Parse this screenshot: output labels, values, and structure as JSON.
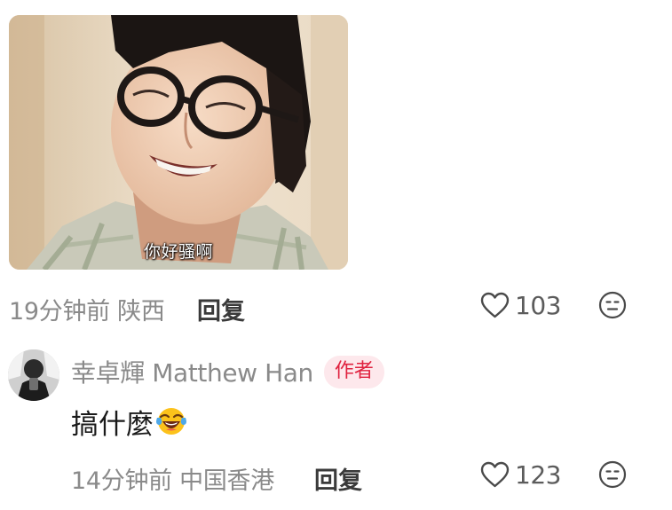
{
  "comment": {
    "image": {
      "caption": "你好骚啊",
      "description": "meme-photo"
    },
    "time_location": "19分钟前 陕西",
    "reply_label": "回复",
    "likes": "103",
    "icons": {
      "like": "heart-outline-icon",
      "dislike": "meh-face-icon"
    }
  },
  "reply": {
    "author": "幸卓輝 Matthew Han",
    "badge": "作者",
    "text": "搞什麼",
    "emoji": "tears-of-joy-emoji",
    "time_location": "14分钟前 中国香港",
    "reply_label": "回复",
    "likes": "123"
  },
  "colors": {
    "meta_gray": "#8a8a8a",
    "badge_bg": "#fde8ec",
    "badge_text": "#e0223f",
    "reply_label": "#3a3a3a"
  }
}
